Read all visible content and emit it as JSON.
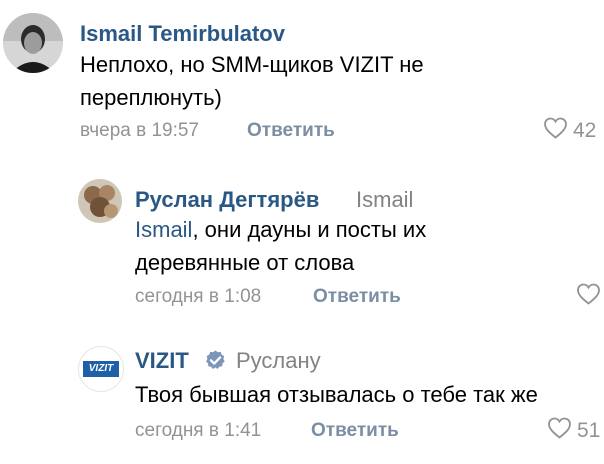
{
  "comments": [
    {
      "author": "Ismail Temirbulatov",
      "reply_to": "",
      "text": "Неплохо, но SMM-щиков VIZIT не переплюнуть)",
      "time": "вчера в 19:57",
      "reply_label": "Ответить",
      "likes": "42"
    },
    {
      "author": "Руслан Дегтярёв",
      "reply_to": "Ismail",
      "mention": "Ismail",
      "text_rest": ", они дауны и посты их деревянные от слова",
      "time": "сегодня в 1:08",
      "reply_label": "Ответить",
      "likes": ""
    },
    {
      "author": "VIZIT",
      "logo_text": "VIZIT",
      "reply_to": "Руслану",
      "text": "Твоя бывшая отзывалась о тебе так же",
      "time": "сегодня в 1:41",
      "reply_label": "Ответить",
      "likes": "51"
    }
  ],
  "colors": {
    "link": "#2a5885",
    "meta": "#939393",
    "verified": "#7b96b8",
    "vizit_logo_bg": "#1e5fa8"
  },
  "icons": [
    "heart-icon",
    "verified-icon"
  ]
}
